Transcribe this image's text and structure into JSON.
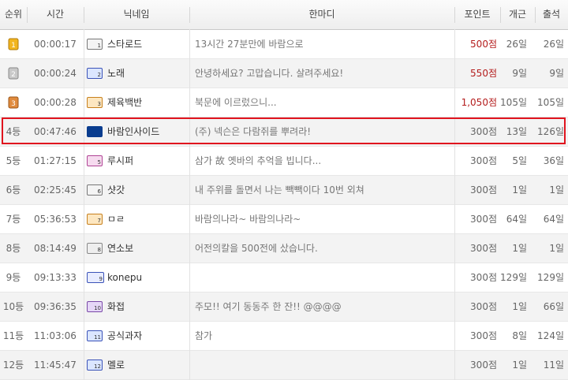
{
  "header": {
    "rank": "순위",
    "time": "시간",
    "nickname": "닉네임",
    "message": "한마디",
    "points": "포인트",
    "count": "개근",
    "attendance": "출석"
  },
  "rows": [
    {
      "rank": "",
      "medal": "gold",
      "time": "00:00:17",
      "badge": "gray",
      "nick": "스타로드",
      "msg": "13시간 27분만에 바람으로",
      "pt": "500점",
      "pt_red": true,
      "cnt": "26일",
      "att": "26일"
    },
    {
      "rank": "",
      "medal": "silver",
      "time": "00:00:24",
      "badge": "blue",
      "nick": "노래",
      "msg": "안녕하세요? 고맙습니다. 살려주세요!",
      "pt": "550점",
      "pt_red": true,
      "cnt": "9일",
      "att": "9일"
    },
    {
      "rank": "",
      "medal": "bronze",
      "time": "00:00:28",
      "badge": "orange",
      "nick": "제육백반",
      "msg": "북문에 이르렀으니...",
      "pt": "1,050점",
      "pt_red": true,
      "cnt": "105일",
      "att": "105일"
    },
    {
      "rank": "4등",
      "time": "00:47:46",
      "badge": "navy",
      "nick": "바람인사이드",
      "msg": "(주) 넥슨은 다람쥐를 뿌려라!",
      "pt": "300점",
      "cnt": "13일",
      "att": "126일"
    },
    {
      "rank": "5등",
      "time": "01:27:15",
      "badge": "pink",
      "nick": "루시퍼",
      "msg": "삼가 故 옛바의 추억을 빕니다...",
      "pt": "300점",
      "cnt": "5일",
      "att": "36일"
    },
    {
      "rank": "6등",
      "time": "02:25:45",
      "badge": "gray",
      "nick": "샷갓",
      "msg": "내 주위를 돌면서 나는 빽빽이다 10번 외쳐",
      "pt": "300점",
      "cnt": "1일",
      "att": "1일"
    },
    {
      "rank": "7등",
      "time": "05:36:53",
      "badge": "orange",
      "nick": "ㅁㄹ",
      "msg": "바람의나라~ 바람의나라~",
      "pt": "300점",
      "cnt": "64일",
      "att": "64일"
    },
    {
      "rank": "8등",
      "time": "08:14:49",
      "badge": "gray2",
      "nick": "연소보",
      "msg": "어전의칼을 500전에 샀습니다.",
      "pt": "300점",
      "cnt": "1일",
      "att": "1일"
    },
    {
      "rank": "9등",
      "time": "09:13:33",
      "badge": "long",
      "nick": "konepu",
      "msg": "",
      "pt": "300점",
      "cnt": "129일",
      "att": "129일"
    },
    {
      "rank": "10등",
      "time": "09:36:35",
      "badge": "purple",
      "nick": "화접",
      "msg": "주모!! 여기 동동주 한 잔!! @@@@",
      "pt": "300점",
      "cnt": "1일",
      "att": "66일"
    },
    {
      "rank": "11등",
      "time": "11:03:06",
      "badge": "blue",
      "nick": "공식과자",
      "msg": "참가",
      "pt": "300점",
      "cnt": "8일",
      "att": "124일"
    },
    {
      "rank": "12등",
      "time": "11:45:47",
      "badge": "blue",
      "nick": "멜로",
      "msg": "",
      "pt": "300점",
      "cnt": "1일",
      "att": "11일"
    }
  ],
  "colors": {
    "highlight": "#e0141e",
    "points_red": "#b41d1d"
  }
}
